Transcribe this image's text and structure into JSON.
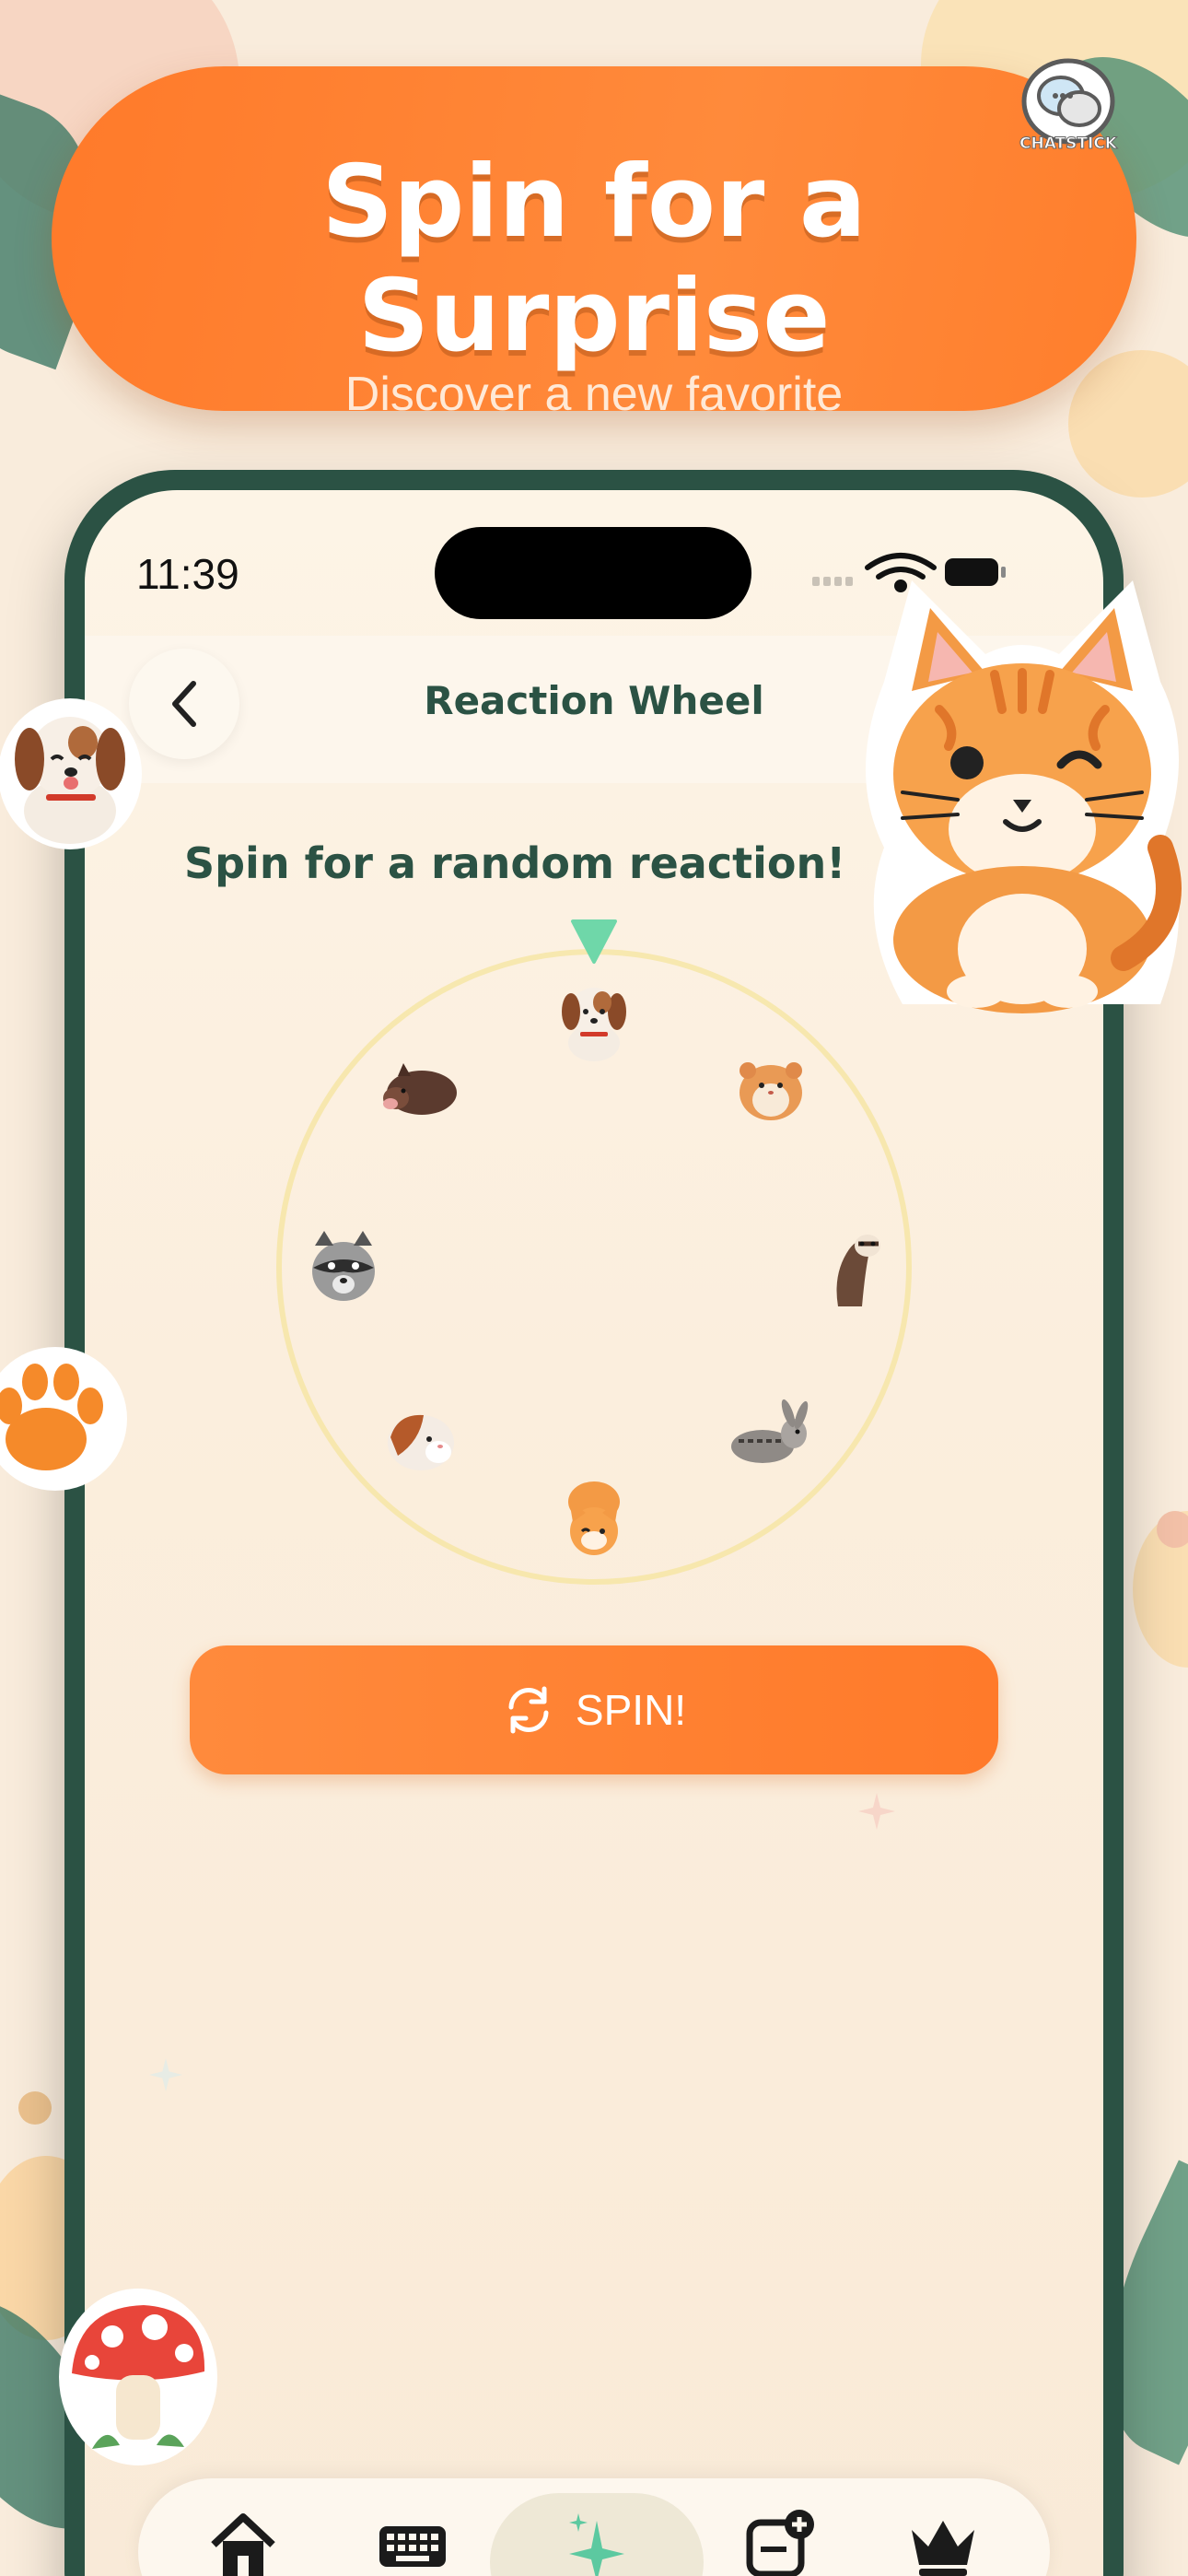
{
  "banner": {
    "title_line1": "Spin for a",
    "title_line2": "Surprise",
    "subtitle": "Discover a new favorite",
    "badge_label": "CHATSTICK"
  },
  "status_bar": {
    "time": "11:39"
  },
  "nav": {
    "title": "Reaction Wheel",
    "back_icon": "chevron-left-icon"
  },
  "main": {
    "prompt": "Spin for a random reaction!",
    "wheel_items": [
      "puppy",
      "hamster",
      "ferret",
      "donkey",
      "cat",
      "guinea-pig",
      "raccoon",
      "boar"
    ],
    "spin_label": "SPIN!",
    "spin_icon": "refresh-icon"
  },
  "tabbar": {
    "tabs": [
      {
        "name": "home",
        "icon": "house-icon"
      },
      {
        "name": "keyboard",
        "icon": "keyboard-icon"
      },
      {
        "name": "sparkle",
        "icon": "sparkle-icon",
        "active": true
      },
      {
        "name": "add-sticker",
        "icon": "sticker-add-icon"
      },
      {
        "name": "premium",
        "icon": "crown-icon"
      }
    ]
  },
  "colors": {
    "accent": "#ff7a2a",
    "dark_green": "#2b5244",
    "pointer_green": "#6fd7a9",
    "background": "#f9ecdc"
  }
}
